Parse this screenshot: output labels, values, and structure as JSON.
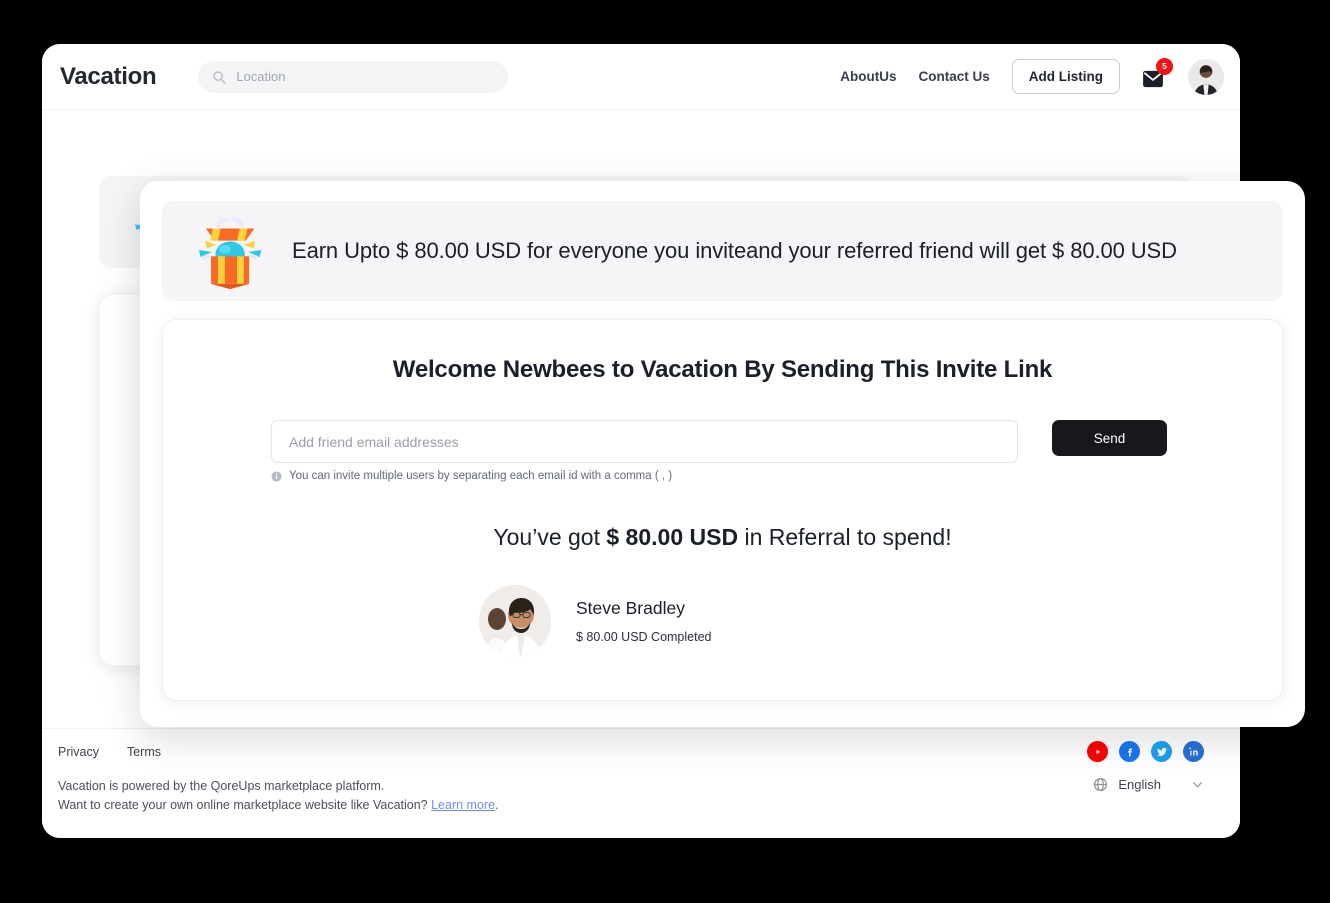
{
  "header": {
    "brand": "Vacation",
    "search": {
      "placeholder": "Location",
      "icon": "search-icon"
    },
    "nav": [
      {
        "label": "AboutUs"
      },
      {
        "label": "Contact Us"
      }
    ],
    "add_listing_label": "Add Listing",
    "mail": {
      "icon": "mail-icon",
      "badge": "5"
    },
    "avatar": {
      "alt": "user-avatar"
    }
  },
  "background": {
    "banner_text": "Earn Upto $ 80.00 USD for everyone you inviteand your referred friend will get $ 80.00",
    "banner_icon": "gift-box-icon"
  },
  "modal": {
    "banner": {
      "icon": "gift-box-icon",
      "text": "Earn Upto $ 80.00 USD for everyone you inviteand your referred friend will get $ 80.00 USD"
    },
    "title": "Welcome Newbees to Vacation By Sending This Invite Link",
    "email_input": {
      "placeholder": "Add friend email addresses",
      "value": ""
    },
    "send_label": "Send",
    "hint": "You can invite multiple users by separating each email id with a comma ( , )",
    "hint_icon": "info-icon",
    "balance": {
      "prefix": "You’ve got ",
      "amount": "$ 80.00 USD",
      "suffix": " in Referral to spend!"
    },
    "referrals": [
      {
        "name": "Steve Bradley",
        "amount_status": "$ 80.00 USD Completed",
        "avatar": "person-avatar"
      }
    ]
  },
  "footer": {
    "links": [
      {
        "label": "Privacy"
      },
      {
        "label": "Terms"
      }
    ],
    "copy_line1": "Vacation is powered by the QoreUps marketplace platform.",
    "copy_line2_pre": "Want to create your own online marketplace website like Vacation? ",
    "copy_link": "Learn more",
    "copy_line2_post": ".",
    "socials": [
      {
        "name": "youtube-icon",
        "color": "#ff0000"
      },
      {
        "name": "facebook-icon",
        "color": "#1877f2"
      },
      {
        "name": "twitter-icon",
        "color": "#1da1f2"
      },
      {
        "name": "linkedin-icon",
        "color": "#2a6fd6"
      }
    ],
    "language": {
      "label": "English",
      "icon": "globe-icon",
      "chevron": "chevron-down-icon"
    }
  }
}
